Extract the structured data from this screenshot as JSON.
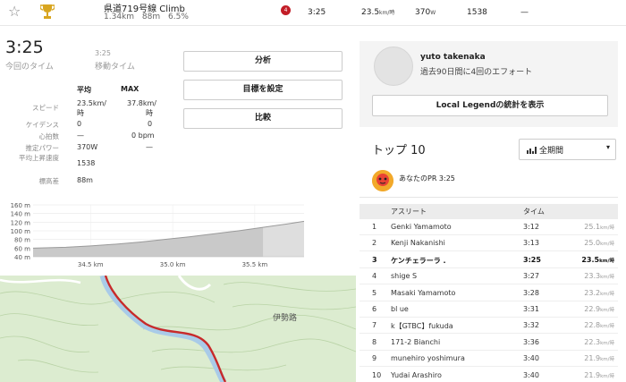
{
  "segment": {
    "name": "県道719号線 Climb",
    "distance": "1.34km",
    "elev_gain": "88m",
    "grade": "6.5%",
    "rank_badge": "4",
    "time": "3:25",
    "speed_value": "23.5",
    "speed_unit": "km/時",
    "power_value": "370",
    "power_unit": "W",
    "vam": "1538",
    "hr": "—"
  },
  "summary": {
    "elapsed_time": "3:25",
    "elapsed_label": "今回のタイム",
    "moving_time": "3:25",
    "moving_label": "移動タイム"
  },
  "buttons": {
    "analyze": "分析",
    "set_goal": "目標を設定",
    "compare": "比較"
  },
  "stats": {
    "col_avg": "平均",
    "col_max": "MAX",
    "rows": [
      {
        "label": "スピード",
        "avg": "23.5km/",
        "avg2": "時",
        "max": "37.8km/",
        "max2": "時"
      },
      {
        "label": "ケイデンス",
        "avg": "0",
        "max": "0"
      },
      {
        "label": "心拍数",
        "avg": "—",
        "max": "0 bpm"
      },
      {
        "label": "推定パワー",
        "avg": "370W",
        "max": "—"
      },
      {
        "label": "平均上昇速度",
        "avg": "1538"
      },
      {
        "label": "標高差",
        "avg": "88m"
      }
    ]
  },
  "chart_data": {
    "type": "area",
    "y_ticks": [
      "160 m",
      "140 m",
      "120 m",
      "100 m",
      "80 m",
      "60 m",
      "40 m"
    ],
    "x_ticks": [
      "34.5 km",
      "35.0 km",
      "35.5 km"
    ],
    "ylim": [
      40,
      160
    ],
    "x": [
      34.15,
      34.35,
      34.5,
      34.65,
      34.8,
      34.95,
      35.1,
      35.25,
      35.4,
      35.55,
      35.7,
      35.8
    ],
    "y": [
      60,
      62,
      65,
      69,
      74,
      80,
      86,
      93,
      100,
      108,
      116,
      122
    ],
    "highlight_range": [
      34.15,
      35.55
    ]
  },
  "map": {
    "place_label": "伊勢路"
  },
  "athlete": {
    "name": "yuto takenaka",
    "efforts": "過去90日間に4回のエフォート",
    "legend_button": "Local Legendの統計を表示"
  },
  "leaderboard": {
    "title": "トップ 10",
    "period": "全期間",
    "pr_text": "あなたのPR 3:25",
    "col_athlete": "アスリート",
    "col_time": "タイム",
    "speed_unit": "km/時",
    "rows": [
      {
        "rank": "1",
        "name": "Genki Yamamoto",
        "time": "3:12",
        "speed": "25.1"
      },
      {
        "rank": "2",
        "name": "Kenji Nakanishi",
        "time": "3:13",
        "speed": "25.0"
      },
      {
        "rank": "3",
        "name": "ケンチェラーラ .",
        "time": "3:25",
        "speed": "23.5"
      },
      {
        "rank": "4",
        "name": "shige S",
        "time": "3:27",
        "speed": "23.3"
      },
      {
        "rank": "5",
        "name": "Masaki Yamamoto",
        "time": "3:28",
        "speed": "23.2"
      },
      {
        "rank": "6",
        "name": "bl ue",
        "time": "3:31",
        "speed": "22.9"
      },
      {
        "rank": "7",
        "name": "k【GTBC】fukuda",
        "time": "3:32",
        "speed": "22.8"
      },
      {
        "rank": "8",
        "name": "171-2 Bianchi",
        "time": "3:36",
        "speed": "22.3"
      },
      {
        "rank": "9",
        "name": "munehiro yoshimura",
        "time": "3:40",
        "speed": "21.9"
      },
      {
        "rank": "10",
        "name": "Yudai Arashiro",
        "time": "3:40",
        "speed": "21.9"
      }
    ]
  },
  "colors": {
    "brand": "#fc4c02",
    "route": "#c82a2a",
    "map_green": "#d9ecc9",
    "river": "#a9cbe8"
  }
}
